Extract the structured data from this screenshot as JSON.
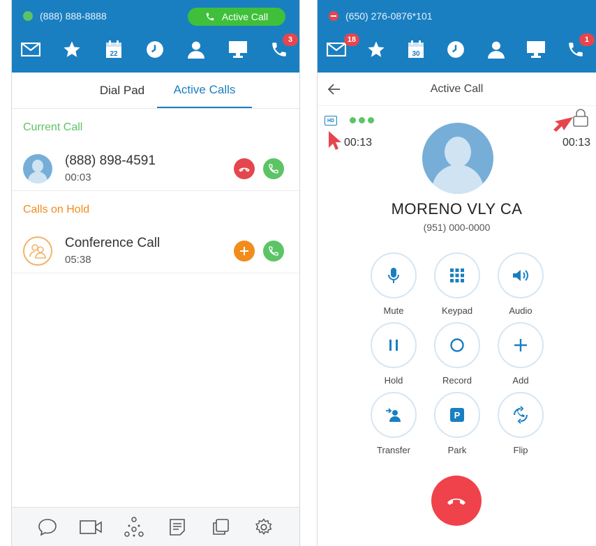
{
  "colors": {
    "brand_blue": "#1a7fc1",
    "green": "#5cc465",
    "red": "#e5464d",
    "orange": "#f28c1c"
  },
  "left": {
    "status_number": "(888) 888-8888",
    "active_call_pill": "Active Call",
    "nav_icons": [
      "mail-icon",
      "star-icon",
      "calendar-icon",
      "clock-icon",
      "contacts-icon",
      "monitor-icon",
      "phone-icon"
    ],
    "calendar_day": "22",
    "phone_badge": "3",
    "tabs": {
      "dial_pad": "Dial Pad",
      "active_calls": "Active Calls"
    },
    "current_call_label": "Current Call",
    "current_call": {
      "number": "(888) 898-4591",
      "duration": "00:03"
    },
    "hold_label": "Calls on Hold",
    "held_call": {
      "name": "Conference Call",
      "duration": "05:38"
    },
    "bottom_icons": [
      "chat-icon",
      "video-icon",
      "hub-icon",
      "notes-icon",
      "copy-icon",
      "settings-icon"
    ]
  },
  "right": {
    "status_number": "(650) 276-0876*101",
    "mail_badge": "18",
    "phone_badge": "1",
    "calendar_day": "30",
    "header_title": "Active Call",
    "hd_label": "HD",
    "timer_left": "00:13",
    "timer_right": "00:13",
    "contact_name": "MORENO VLY  CA",
    "contact_number": "(951) 000-0000",
    "actions": {
      "mute": "Mute",
      "keypad": "Keypad",
      "audio": "Audio",
      "hold": "Hold",
      "record": "Record",
      "add": "Add",
      "transfer": "Transfer",
      "park": "Park",
      "flip": "Flip"
    },
    "park_glyph": "P"
  }
}
